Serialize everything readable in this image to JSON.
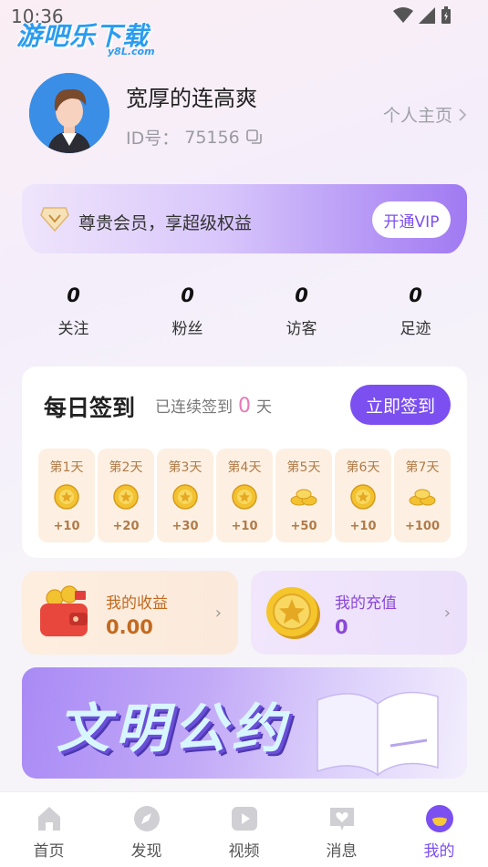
{
  "status_bar": {
    "time": "10:36"
  },
  "watermark": {
    "main": "游吧乐下载",
    "sub": "y8L.com"
  },
  "profile": {
    "username": "宽厚的连高爽",
    "id_label": "ID号：",
    "id_value": "75156",
    "home_link": "个人主页"
  },
  "vip": {
    "text": "尊贵会员，享超级权益",
    "button": "开通VIP"
  },
  "stats": [
    {
      "value": "0",
      "label": "关注"
    },
    {
      "value": "0",
      "label": "粉丝"
    },
    {
      "value": "0",
      "label": "访客"
    },
    {
      "value": "0",
      "label": "足迹"
    }
  ],
  "signin": {
    "title": "每日签到",
    "streak_prefix": "已连续签到",
    "streak_count": "0",
    "streak_suffix": "天",
    "button": "立即签到",
    "days": [
      {
        "label": "第1天",
        "reward": "+10",
        "icon": "coin-icon"
      },
      {
        "label": "第2天",
        "reward": "+20",
        "icon": "coin-icon"
      },
      {
        "label": "第3天",
        "reward": "+30",
        "icon": "coin-icon"
      },
      {
        "label": "第4天",
        "reward": "+10",
        "icon": "coin-icon"
      },
      {
        "label": "第5天",
        "reward": "+50",
        "icon": "gold-ingot-icon"
      },
      {
        "label": "第6天",
        "reward": "+10",
        "icon": "coin-icon"
      },
      {
        "label": "第7天",
        "reward": "+100",
        "icon": "gold-ingot-icon"
      }
    ]
  },
  "wallet": {
    "income": {
      "label": "我的收益",
      "value": "0.00"
    },
    "recharge": {
      "label": "我的充值",
      "value": "0"
    }
  },
  "banner": {
    "text": "文明公约"
  },
  "tabbar": {
    "items": [
      {
        "label": "首页",
        "icon": "home-icon"
      },
      {
        "label": "发现",
        "icon": "compass-icon"
      },
      {
        "label": "视频",
        "icon": "video-icon"
      },
      {
        "label": "消息",
        "icon": "message-icon"
      },
      {
        "label": "我的",
        "icon": "profile-icon"
      }
    ],
    "active": "我的"
  },
  "colors": {
    "accent": "#7b4ff0",
    "streak": "#e879b8",
    "income": "#c26a20",
    "recharge": "#8a48d8",
    "gold": "#f2c230"
  }
}
